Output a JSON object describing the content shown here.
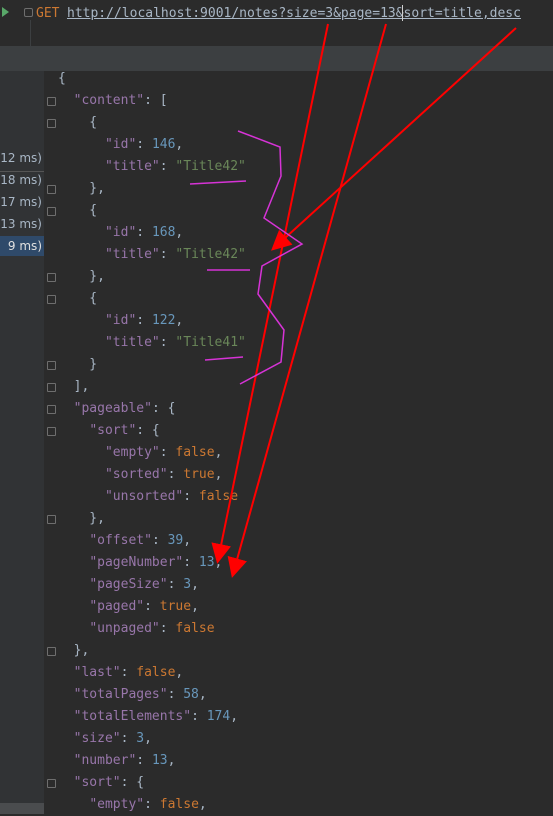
{
  "request": {
    "method": "GET",
    "url": "http://localhost:9001/notes?size=3&page=13&sort=title,desc"
  },
  "timings": [
    "12 ms)",
    "18 ms)",
    "17 ms)",
    "13 ms)",
    "9 ms)"
  ],
  "selected_timing_index": 4,
  "json_lines": [
    [
      [
        "p",
        "{"
      ]
    ],
    [
      [
        "p",
        "  "
      ],
      [
        "k",
        "\"content\""
      ],
      [
        "p",
        ": ["
      ]
    ],
    [
      [
        "p",
        "    {"
      ]
    ],
    [
      [
        "p",
        "      "
      ],
      [
        "k",
        "\"id\""
      ],
      [
        "p",
        ": "
      ],
      [
        "n",
        "146"
      ],
      [
        "p",
        ","
      ]
    ],
    [
      [
        "p",
        "      "
      ],
      [
        "k",
        "\"title\""
      ],
      [
        "p",
        ": "
      ],
      [
        "s",
        "\"Title42\""
      ]
    ],
    [
      [
        "p",
        "    },"
      ]
    ],
    [
      [
        "p",
        "    {"
      ]
    ],
    [
      [
        "p",
        "      "
      ],
      [
        "k",
        "\"id\""
      ],
      [
        "p",
        ": "
      ],
      [
        "n",
        "168"
      ],
      [
        "p",
        ","
      ]
    ],
    [
      [
        "p",
        "      "
      ],
      [
        "k",
        "\"title\""
      ],
      [
        "p",
        ": "
      ],
      [
        "s",
        "\"Title42\""
      ]
    ],
    [
      [
        "p",
        "    },"
      ]
    ],
    [
      [
        "p",
        "    {"
      ]
    ],
    [
      [
        "p",
        "      "
      ],
      [
        "k",
        "\"id\""
      ],
      [
        "p",
        ": "
      ],
      [
        "n",
        "122"
      ],
      [
        "p",
        ","
      ]
    ],
    [
      [
        "p",
        "      "
      ],
      [
        "k",
        "\"title\""
      ],
      [
        "p",
        ": "
      ],
      [
        "s",
        "\"Title41\""
      ]
    ],
    [
      [
        "p",
        "    }"
      ]
    ],
    [
      [
        "p",
        "  ],"
      ]
    ],
    [
      [
        "p",
        "  "
      ],
      [
        "k",
        "\"pageable\""
      ],
      [
        "p",
        ": {"
      ]
    ],
    [
      [
        "p",
        "    "
      ],
      [
        "k",
        "\"sort\""
      ],
      [
        "p",
        ": {"
      ]
    ],
    [
      [
        "p",
        "      "
      ],
      [
        "k",
        "\"empty\""
      ],
      [
        "p",
        ": "
      ],
      [
        "b",
        "false"
      ],
      [
        "p",
        ","
      ]
    ],
    [
      [
        "p",
        "      "
      ],
      [
        "k",
        "\"sorted\""
      ],
      [
        "p",
        ": "
      ],
      [
        "b",
        "true"
      ],
      [
        "p",
        ","
      ]
    ],
    [
      [
        "p",
        "      "
      ],
      [
        "k",
        "\"unsorted\""
      ],
      [
        "p",
        ": "
      ],
      [
        "b",
        "false"
      ]
    ],
    [
      [
        "p",
        "    },"
      ]
    ],
    [
      [
        "p",
        "    "
      ],
      [
        "k",
        "\"offset\""
      ],
      [
        "p",
        ": "
      ],
      [
        "n",
        "39"
      ],
      [
        "p",
        ","
      ]
    ],
    [
      [
        "p",
        "    "
      ],
      [
        "k",
        "\"pageNumber\""
      ],
      [
        "p",
        ": "
      ],
      [
        "n",
        "13"
      ],
      [
        "p",
        ","
      ]
    ],
    [
      [
        "p",
        "    "
      ],
      [
        "k",
        "\"pageSize\""
      ],
      [
        "p",
        ": "
      ],
      [
        "n",
        "3"
      ],
      [
        "p",
        ","
      ]
    ],
    [
      [
        "p",
        "    "
      ],
      [
        "k",
        "\"paged\""
      ],
      [
        "p",
        ": "
      ],
      [
        "b",
        "true"
      ],
      [
        "p",
        ","
      ]
    ],
    [
      [
        "p",
        "    "
      ],
      [
        "k",
        "\"unpaged\""
      ],
      [
        "p",
        ": "
      ],
      [
        "b",
        "false"
      ]
    ],
    [
      [
        "p",
        "  },"
      ]
    ],
    [
      [
        "p",
        "  "
      ],
      [
        "k",
        "\"last\""
      ],
      [
        "p",
        ": "
      ],
      [
        "b",
        "false"
      ],
      [
        "p",
        ","
      ]
    ],
    [
      [
        "p",
        "  "
      ],
      [
        "k",
        "\"totalPages\""
      ],
      [
        "p",
        ": "
      ],
      [
        "n",
        "58"
      ],
      [
        "p",
        ","
      ]
    ],
    [
      [
        "p",
        "  "
      ],
      [
        "k",
        "\"totalElements\""
      ],
      [
        "p",
        ": "
      ],
      [
        "n",
        "174"
      ],
      [
        "p",
        ","
      ]
    ],
    [
      [
        "p",
        "  "
      ],
      [
        "k",
        "\"size\""
      ],
      [
        "p",
        ": "
      ],
      [
        "n",
        "3"
      ],
      [
        "p",
        ","
      ]
    ],
    [
      [
        "p",
        "  "
      ],
      [
        "k",
        "\"number\""
      ],
      [
        "p",
        ": "
      ],
      [
        "n",
        "13"
      ],
      [
        "p",
        ","
      ]
    ],
    [
      [
        "p",
        "  "
      ],
      [
        "k",
        "\"sort\""
      ],
      [
        "p",
        ": {"
      ]
    ],
    [
      [
        "p",
        "    "
      ],
      [
        "k",
        "\"empty\""
      ],
      [
        "p",
        ": "
      ],
      [
        "b",
        "false"
      ],
      [
        "p",
        ","
      ]
    ]
  ],
  "colors": {
    "background": "#2b2b2b",
    "json_key": "#9876aa",
    "json_string": "#6a8759",
    "json_number": "#6897bb",
    "json_keyword": "#cc7832",
    "annotation_arrow": "#ff0000",
    "annotation_scribble": "#d633d6"
  },
  "icons": {
    "run": "run-icon",
    "fold": "fold-marker-icon"
  }
}
